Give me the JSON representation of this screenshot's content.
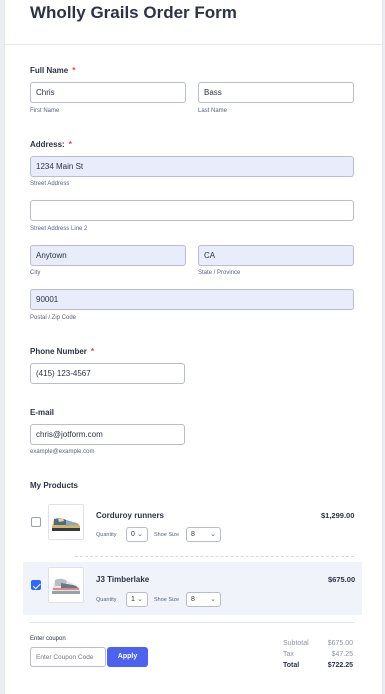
{
  "form": {
    "title": "Wholly Grails Order Form"
  },
  "full_name": {
    "label": "Full Name",
    "required_mark": "*",
    "first_value": "Chris",
    "first_sublabel": "First Name",
    "last_value": "Bass",
    "last_sublabel": "Last Name"
  },
  "address": {
    "label": "Address:",
    "required_mark": "*",
    "street_value": "1234 Main St",
    "street_sublabel": "Street Address",
    "line2_value": "",
    "line2_sublabel": "Street Address Line 2",
    "city_value": "Anytown",
    "city_sublabel": "City",
    "state_value": "CA",
    "state_sublabel": "State / Province",
    "zip_value": "90001",
    "zip_sublabel": "Postal / Zip Code"
  },
  "phone": {
    "label": "Phone Number",
    "required_mark": "*",
    "value": "(415) 123-4567"
  },
  "email": {
    "label": "E-mail",
    "value": "chris@jotform.com",
    "sublabel": "example@example.com"
  },
  "products": {
    "label": "My Products",
    "items": [
      {
        "name": "Corduroy runners",
        "price": "$1,299.00",
        "checked": false,
        "quantity_label": "Quantity",
        "quantity": "0",
        "size_label": "Shoe Size",
        "size": "8"
      },
      {
        "name": "J3 Timberlake",
        "price": "$675.00",
        "checked": true,
        "quantity_label": "Quantity",
        "quantity": "1",
        "size_label": "Shoe Size",
        "size": "8"
      }
    ]
  },
  "coupon": {
    "label": "Enter coupon",
    "placeholder": "Enter Coupon Code",
    "apply_label": "Apply"
  },
  "summary": {
    "subtotal_label": "Subtotal",
    "subtotal_value": "$675.00",
    "tax_label": "Tax",
    "tax_value": "$47.25",
    "total_label": "Total",
    "total_value": "$722.25"
  },
  "colors": {
    "accent": "#4c63f1",
    "checkbox": "#2e69ff",
    "required": "#f23a3c",
    "filled_input": "#e8ecfb"
  }
}
